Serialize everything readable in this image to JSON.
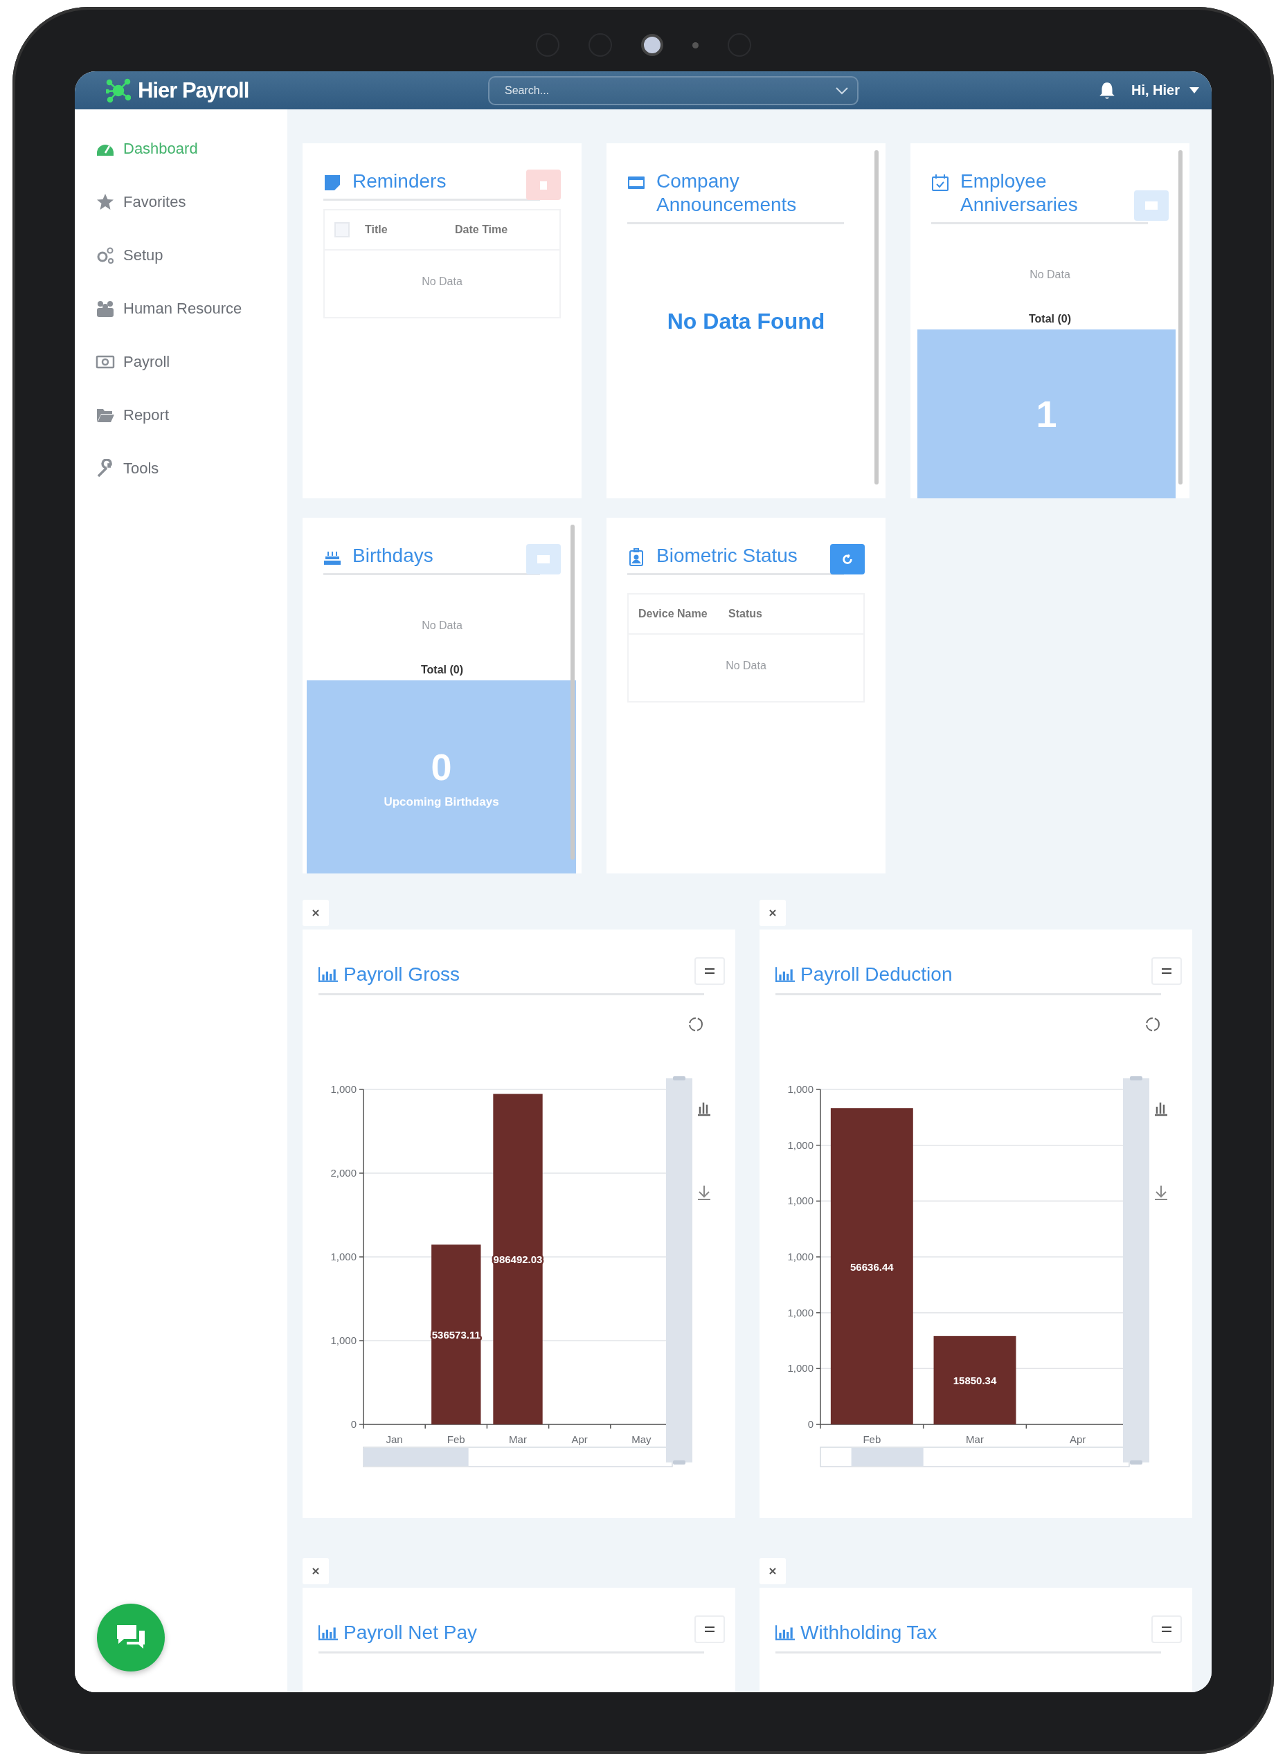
{
  "app": {
    "title": "Hier Payroll",
    "search": {
      "placeholder": "Search..."
    },
    "user": "Hi, Hier"
  },
  "sidebar": {
    "items": [
      {
        "label": "Dashboard",
        "selected": true
      },
      {
        "label": "Favorites",
        "selected": false
      },
      {
        "label": "Setup",
        "selected": false
      },
      {
        "label": "Human Resource",
        "selected": false
      },
      {
        "label": "Payroll",
        "selected": false
      },
      {
        "label": "Report",
        "selected": false
      },
      {
        "label": "Tools",
        "selected": false
      }
    ]
  },
  "cards": [
    {
      "kind": "reminders",
      "title": "Reminders",
      "checked": false,
      "columns": [
        "Title",
        "Date Time"
      ],
      "empty": "No Data"
    },
    {
      "kind": "announcements",
      "title": "Company Announcements",
      "empty": "No Data Found"
    },
    {
      "kind": "anniversaries",
      "title": "Employee Anniversaries",
      "empty": "No Data",
      "total": "Total (0)",
      "count": "1"
    },
    {
      "kind": "birthdays",
      "title": "Birthdays",
      "empty": "No Data",
      "total": "Total (0)",
      "count": "0",
      "caption": "Upcoming Birthdays"
    },
    {
      "kind": "biometric",
      "title": "Biometric Status",
      "columns": [
        "Device Name",
        "Status"
      ],
      "empty": "No Data"
    }
  ],
  "charts": [
    {
      "title": "Payroll Gross",
      "chart_data": {
        "type": "bar",
        "categories": [
          "Jan",
          "Feb",
          "Mar",
          "Apr",
          "May"
        ],
        "series": [
          {
            "color": "#6b2d2a",
            "values": [
              null,
              536573.11,
              986492.03,
              null,
              null
            ]
          }
        ],
        "ylim": [
          0,
          1000000
        ],
        "data_labels": true
      },
      "y_axis_labels": [
        "1,000",
        "2,000",
        "1,000",
        "1,000",
        "0"
      ]
    },
    {
      "title": "Payroll Deduction",
      "chart_data": {
        "type": "bar",
        "categories": [
          "Feb",
          "Mar",
          "Apr"
        ],
        "series": [
          {
            "color": "#6b2d2a",
            "values": [
              56636.44,
              15850.34,
              null
            ]
          }
        ],
        "ylim": [
          0,
          60000
        ],
        "data_labels": true
      },
      "y_axis_labels": [
        "1,000",
        "1,000",
        "1,000",
        "1,000",
        "1,000",
        "1,000",
        "0"
      ]
    }
  ],
  "lower_panels": [
    {
      "title": "Payroll Net Pay"
    },
    {
      "title": "Withholding Tax"
    }
  ]
}
